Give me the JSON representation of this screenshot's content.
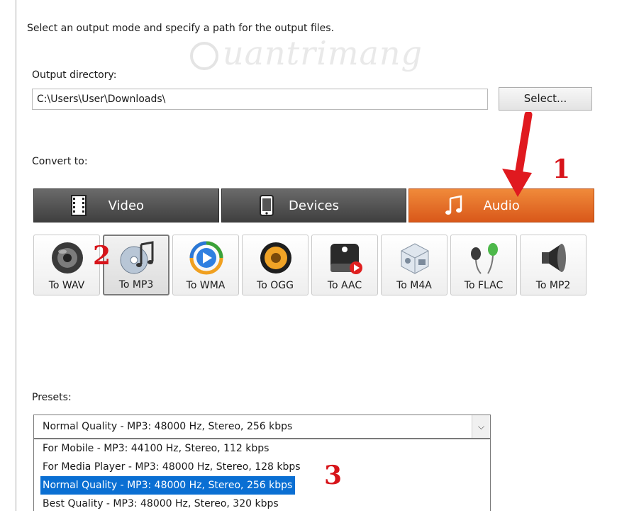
{
  "intro": "Select an output mode and specify a path for the output files.",
  "watermark": "uantrimang",
  "output": {
    "label": "Output directory:",
    "path": "C:\\Users\\User\\Downloads\\",
    "select_label": "Select..."
  },
  "convert_label": "Convert to:",
  "tabs": [
    {
      "label": "Video",
      "icon": "film-icon",
      "active": false
    },
    {
      "label": "Devices",
      "icon": "phone-icon",
      "active": false
    },
    {
      "label": "Audio",
      "icon": "music-note-icon",
      "active": true
    }
  ],
  "formats": [
    {
      "label": "To WAV",
      "icon": "speaker-icon",
      "selected": false
    },
    {
      "label": "To MP3",
      "icon": "cd-music-icon",
      "selected": true
    },
    {
      "label": "To WMA",
      "icon": "media-player-icon",
      "selected": false
    },
    {
      "label": "To OGG",
      "icon": "ogg-speaker-icon",
      "selected": false
    },
    {
      "label": "To AAC",
      "icon": "apple-aac-icon",
      "selected": false
    },
    {
      "label": "To M4A",
      "icon": "cube-icon",
      "selected": false
    },
    {
      "label": "To FLAC",
      "icon": "earphones-icon",
      "selected": false
    },
    {
      "label": "To MP2",
      "icon": "loudspeaker-icon",
      "selected": false
    }
  ],
  "presets": {
    "label": "Presets:",
    "selected": "Normal Quality - MP3: 48000 Hz, Stereo, 256 kbps",
    "options": [
      "For Mobile - MP3: 44100 Hz, Stereo, 112 kbps",
      "For Media Player - MP3: 48000 Hz, Stereo, 128 kbps",
      "Normal Quality - MP3: 48000 Hz, Stereo, 256 kbps",
      "Best Quality - MP3: 48000 Hz, Stereo, 320 kbps"
    ],
    "highlighted_index": 2
  },
  "annotations": {
    "step1": "1",
    "step2": "2",
    "step3": "3"
  },
  "colors": {
    "accent": "#e0641f",
    "highlight": "#0a6fd3",
    "annotation": "#d7141a"
  }
}
